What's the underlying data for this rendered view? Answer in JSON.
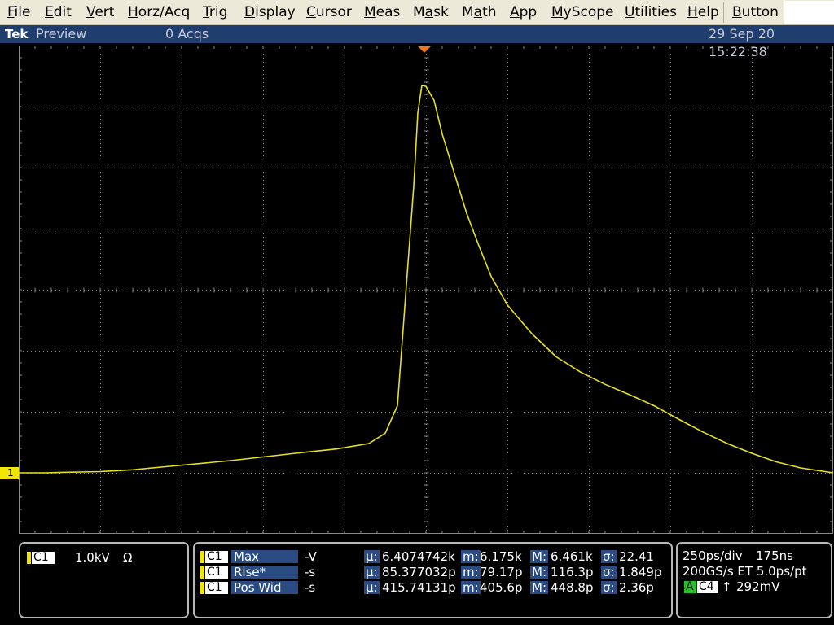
{
  "menubar": {
    "items": [
      {
        "label": "File",
        "hot": 0
      },
      {
        "label": "Edit",
        "hot": 0
      },
      {
        "label": "Vert",
        "hot": 0
      },
      {
        "label": "Horz/Acq",
        "hot": 0
      },
      {
        "label": "Trig",
        "hot": 0
      },
      {
        "label": "Display",
        "hot": 0
      },
      {
        "label": "Cursor",
        "hot": 0
      },
      {
        "label": "Meas",
        "hot": 0
      },
      {
        "label": "Mask",
        "hot": 1
      },
      {
        "label": "Math",
        "hot": 1
      },
      {
        "label": "App",
        "hot": 0
      },
      {
        "label": "MyScope",
        "hot": 0
      },
      {
        "label": "Utilities",
        "hot": 0
      },
      {
        "label": "Help",
        "hot": 0
      },
      {
        "label": "Button",
        "hot": 0
      }
    ]
  },
  "status": {
    "brand": "Tek",
    "mode": "Preview",
    "acqs": "0 Acqs",
    "datetime": "29 Sep 20 15:22:38"
  },
  "colors": {
    "trace": "#e8e01e",
    "grid": "#8a8a8a",
    "menu_bg": "#ece9d8",
    "status_bg": "#1f3d6f",
    "label_bg": "#2b4b83",
    "channel_marker": "#f2e600",
    "trigger_marker": "#f07818",
    "trigger_source_bg": "#22c022"
  },
  "channel": {
    "marker": "1",
    "name": "C1",
    "scale": "1.0kV",
    "termination": "Ω"
  },
  "measurements": [
    {
      "source": "C1",
      "name": "Max",
      "value": "-V",
      "mean_label": "µ:",
      "mean": "6.4074742k",
      "min_label": "m:",
      "min": "6.175k",
      "max_label": "M:",
      "max": "6.461k",
      "sd_label": "σ:",
      "sd": "22.41"
    },
    {
      "source": "C1",
      "name": "Rise*",
      "value": "-s",
      "mean_label": "µ:",
      "mean": "85.377032p",
      "min_label": "m:",
      "min": "79.17p",
      "max_label": "M:",
      "max": "116.3p",
      "sd_label": "σ:",
      "sd": "1.849p"
    },
    {
      "source": "C1",
      "name": "Pos Wid",
      "value": "-s",
      "mean_label": "µ:",
      "mean": "415.74131p",
      "min_label": "m:",
      "min": "405.6p",
      "max_label": "M:",
      "max": "448.8p",
      "sd_label": "σ:",
      "sd": "2.36p"
    }
  ],
  "horizontal": {
    "scale": "250ps/div",
    "position": "175ns",
    "rate": "200GS/s ET 5.0ps/pt",
    "trigger_mode": "A",
    "trigger_source": "C4",
    "trigger_slope": "↑",
    "trigger_level": "292mV"
  },
  "chart_data": {
    "type": "line",
    "title": "",
    "xlabel": "",
    "ylabel": "",
    "x_units": "divisions",
    "y_units": "divisions",
    "xlim": [
      0,
      10
    ],
    "ylim": [
      -4,
      4
    ],
    "grid": true,
    "series": [
      {
        "x": [
          0.0,
          0.3,
          0.6,
          1.0,
          1.4,
          1.8,
          2.2,
          2.6,
          3.0,
          3.4,
          3.9,
          4.3,
          4.5,
          4.65,
          4.75,
          4.85,
          4.9,
          4.95,
          5.0,
          5.1,
          5.2,
          5.35,
          5.5,
          5.65,
          5.8,
          6.0,
          6.3,
          6.6,
          6.9,
          7.2,
          7.5,
          7.8,
          8.1,
          8.4,
          8.7,
          9.0,
          9.3,
          9.6,
          10.0
        ],
        "y": [
          -3.0,
          -3.0,
          -2.99,
          -2.98,
          -2.95,
          -2.9,
          -2.85,
          -2.8,
          -2.74,
          -2.68,
          -2.61,
          -2.52,
          -2.35,
          -1.9,
          -0.1,
          1.7,
          2.9,
          3.35,
          3.33,
          3.1,
          2.55,
          1.9,
          1.25,
          0.72,
          0.22,
          -0.25,
          -0.72,
          -1.1,
          -1.35,
          -1.55,
          -1.72,
          -1.9,
          -2.12,
          -2.33,
          -2.52,
          -2.68,
          -2.82,
          -2.92,
          -3.0
        ]
      }
    ]
  }
}
